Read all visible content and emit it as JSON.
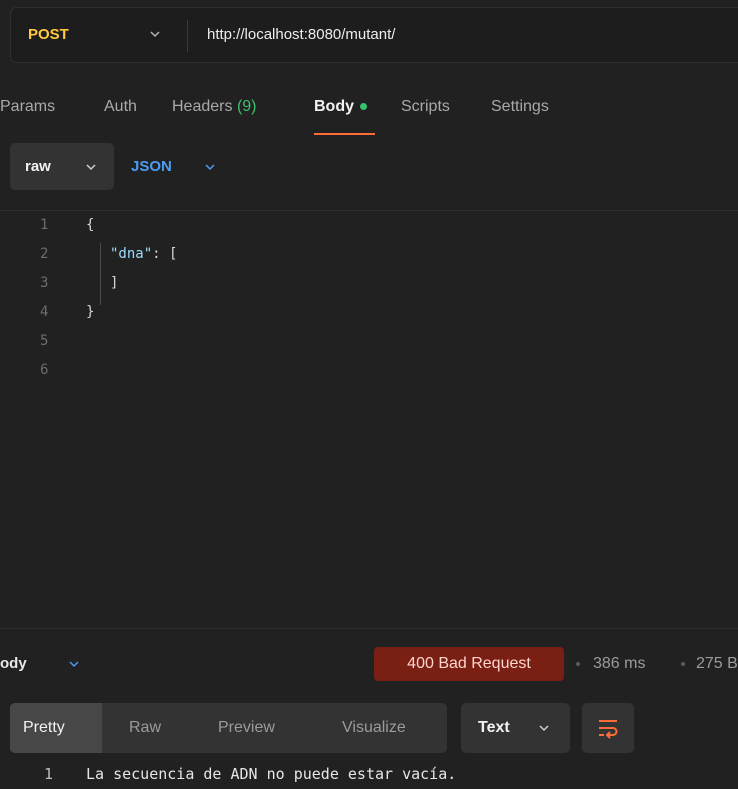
{
  "request": {
    "method": "POST",
    "url": "http://localhost:8080/mutant/"
  },
  "tabs": [
    {
      "label": "Params"
    },
    {
      "label": "Auth"
    },
    {
      "label": "Headers",
      "count": "(9)"
    },
    {
      "label": "Body"
    },
    {
      "label": "Scripts"
    },
    {
      "label": "Settings"
    }
  ],
  "body_format": {
    "mode": "raw",
    "language": "JSON"
  },
  "editor": {
    "line_numbers": [
      "1",
      "2",
      "3",
      "4",
      "5",
      "6"
    ],
    "lines": [
      "{",
      "\"dna\"",
      ": [",
      "]",
      "}"
    ]
  },
  "response": {
    "section_label": "ody",
    "status": "400 Bad Request",
    "time": "386 ms",
    "size": "275 B",
    "view_tabs": [
      "Pretty",
      "Raw",
      "Preview",
      "Visualize"
    ],
    "view_type": "Text",
    "line_number": "1",
    "line_text": "La secuencia de ADN no puede estar vacía."
  },
  "colors": {
    "method": "#ffc83d",
    "accent": "#ff6c37",
    "json": "#4c9df2",
    "status_bg": "#7a1f14",
    "success_dot": "#35c46d"
  }
}
